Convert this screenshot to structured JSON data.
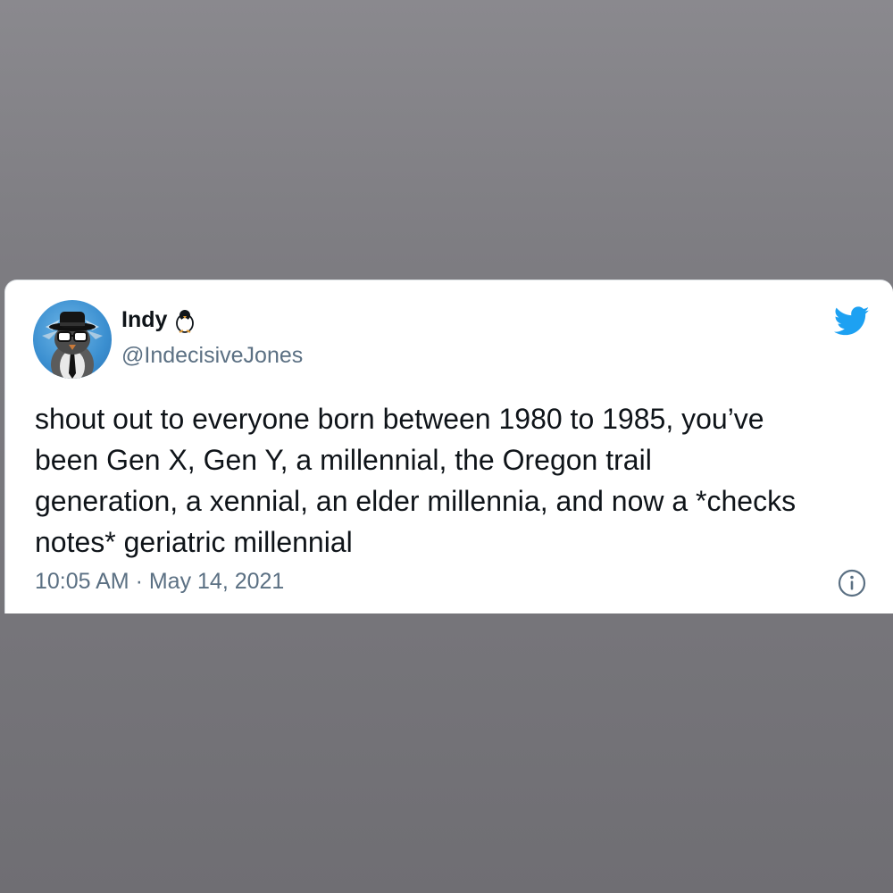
{
  "tweet": {
    "display_name": "Indy",
    "handle": "@IndecisiveJones",
    "text": "shout out to everyone born between 1980 to 1985, you’ve\nbeen Gen X, Gen Y, a millennial, the Oregon trail\ngeneration, a xennial, an elder millennia, and now a *checks\nnotes* geriatric millennial",
    "timestamp": "10:05 AM · May 14, 2021"
  },
  "icons": {
    "name_emoji": "penguin-icon",
    "brand": "twitter-bird-icon",
    "info": "info-icon"
  },
  "colors": {
    "brand": "#1da1f2",
    "text": "#0f1419",
    "secondary": "#5b7083",
    "backdrop": "#7c7b80"
  }
}
